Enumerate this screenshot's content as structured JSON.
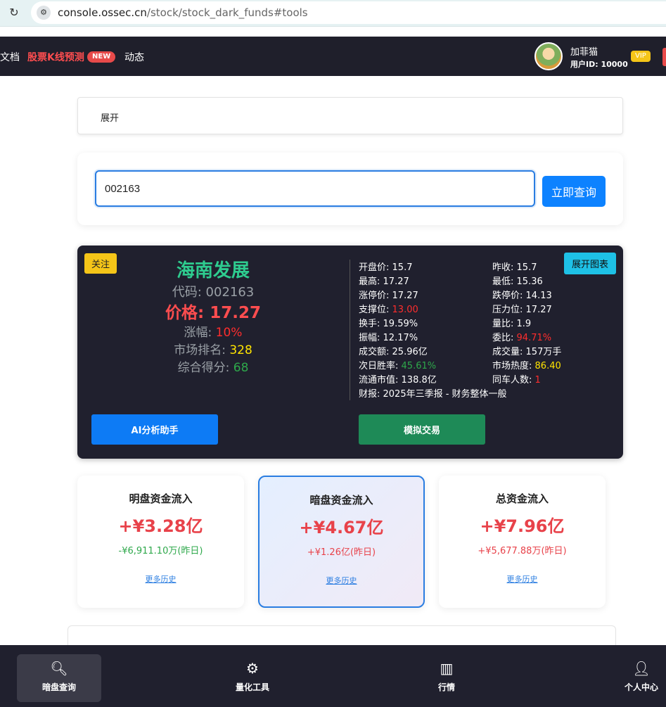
{
  "browser": {
    "url_domain": "console.ossec.cn",
    "url_path": "/stock/stock_dark_funds#tools"
  },
  "nav": {
    "docs": "文档",
    "kline": "股票K线预测",
    "new_badge": "NEW",
    "dynamics": "动态",
    "user_name": "加菲猫",
    "user_id": "用户ID: 10000",
    "vip": "VIP"
  },
  "expand": {
    "label": "展开"
  },
  "search": {
    "value": "002163",
    "button": "立即查询"
  },
  "stock": {
    "follow": "关注",
    "expand_chart": "展开图表",
    "name": "海南发展",
    "code_label": "代码:",
    "code": "002163",
    "price_label": "价格:",
    "price": "17.27",
    "change_label": "涨幅:",
    "change": "10%",
    "rank_label": "市场排名:",
    "rank": "328",
    "score_label": "综合得分:",
    "score": "68",
    "metrics": [
      {
        "label": "开盘价:",
        "value": "15.7"
      },
      {
        "label": "昨收:",
        "value": "15.7"
      },
      {
        "label": "最高:",
        "value": "17.27"
      },
      {
        "label": "最低:",
        "value": "15.36"
      },
      {
        "label": "涨停价:",
        "value": "17.27"
      },
      {
        "label": "跌停价:",
        "value": "14.13"
      },
      {
        "label": "支撑位:",
        "value": "13.00"
      },
      {
        "label": "压力位:",
        "value": "17.27"
      },
      {
        "label": "换手:",
        "value": "19.59%"
      },
      {
        "label": "量比:",
        "value": "1.9"
      },
      {
        "label": "振幅:",
        "value": "12.17%"
      },
      {
        "label": "委比:",
        "value": "94.71%"
      },
      {
        "label": "成交额:",
        "value": "25.96亿"
      },
      {
        "label": "成交量:",
        "value": "157万手"
      },
      {
        "label": "次日胜率:",
        "value": "45.61%"
      },
      {
        "label": "市场热度:",
        "value": "86.40"
      },
      {
        "label": "流通市值:",
        "value": "138.8亿"
      },
      {
        "label": "同车人数:",
        "value": "1"
      }
    ],
    "report": "财报: 2025年三季报 - 财务整体一般",
    "ai_button": "AI分析助手",
    "trade_button": "模拟交易"
  },
  "flows": [
    {
      "title": "明盘资金流入",
      "amount": "+¥3.28亿",
      "yesterday": "-¥6,911.10万(昨日)",
      "yesterday_color": "#2ea84b",
      "more": "更多历史"
    },
    {
      "title": "暗盘资金流入",
      "amount": "+¥4.67亿",
      "yesterday": "+¥1.26亿(昨日)",
      "yesterday_color": "#e8424a",
      "more": "更多历史"
    },
    {
      "title": "总资金流入",
      "amount": "+¥7.96亿",
      "yesterday": "+¥5,677.88万(昨日)",
      "yesterday_color": "#e8424a",
      "more": "更多历史"
    }
  ],
  "tabs": [
    {
      "label": "暗盘查询",
      "icon": "search-icon"
    },
    {
      "label": "量化工具",
      "icon": "gear-icon"
    },
    {
      "label": "行情",
      "icon": "chart-icon"
    },
    {
      "label": "个人中心",
      "icon": "user-icon"
    }
  ]
}
